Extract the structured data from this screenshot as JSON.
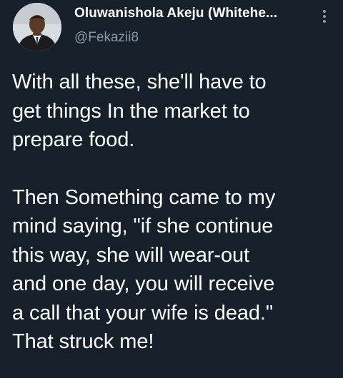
{
  "author": {
    "name": "Oluwanishola Akeju (Whitehe...",
    "handle": "@Fekazii8"
  },
  "icons": {
    "avatar": "profile-photo",
    "more": "more-options-vertical-dots-icon"
  },
  "tweet": {
    "paragraphs": [
      {
        "lines": [
          "With all these, she'll have to",
          "get things In the market to",
          "prepare food."
        ]
      },
      {
        "lines": [
          "Then Something came to my",
          "mind saying, \"if she continue",
          "this way, she will wear-out",
          "and one day, you will receive",
          "a call that your wife is dead.\"",
          "That struck me!"
        ]
      }
    ]
  },
  "colors": {
    "background": "#15202b",
    "primary_text": "#ffffff",
    "secondary_text": "#8899a6"
  }
}
